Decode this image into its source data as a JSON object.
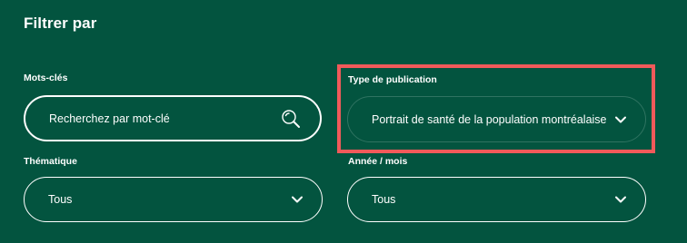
{
  "filter_panel": {
    "title": "Filtrer par",
    "keywords": {
      "label": "Mots-clés",
      "placeholder": "Recherchez par mot-clé",
      "icon": "search-icon"
    },
    "publication_type": {
      "label": "Type de publication",
      "selected": "Portrait de santé de la population montréalaise",
      "icon": "chevron-down-icon"
    },
    "thematic": {
      "label": "Thématique",
      "selected": "Tous",
      "icon": "chevron-down-icon"
    },
    "year_month": {
      "label": "Année / mois",
      "selected": "Tous",
      "icon": "chevron-down-icon"
    }
  },
  "colors": {
    "background": "#03543f",
    "text": "#ffffff",
    "highlight": "#f25a5a"
  }
}
